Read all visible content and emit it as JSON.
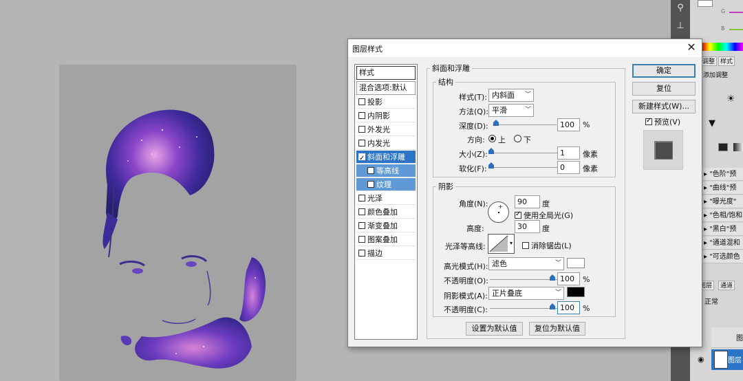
{
  "dialog": {
    "title": "图层样式",
    "close_icon": "close-icon"
  },
  "style_list": {
    "header": "样式",
    "blend_options": "混合选项:默认",
    "items": [
      {
        "label": "投影",
        "checked": false
      },
      {
        "label": "内阴影",
        "checked": false
      },
      {
        "label": "外发光",
        "checked": false
      },
      {
        "label": "内发光",
        "checked": false
      },
      {
        "label": "斜面和浮雕",
        "checked": true,
        "selected": true
      },
      {
        "label": "等高线",
        "checked": false,
        "sub": true
      },
      {
        "label": "纹理",
        "checked": false,
        "sub": true
      },
      {
        "label": "光泽",
        "checked": false
      },
      {
        "label": "颜色叠加",
        "checked": false
      },
      {
        "label": "渐变叠加",
        "checked": false
      },
      {
        "label": "图案叠加",
        "checked": false
      },
      {
        "label": "描边",
        "checked": false
      }
    ]
  },
  "bevel": {
    "title": "斜面和浮雕",
    "structure": {
      "title": "结构",
      "style_label": "样式(T):",
      "style_value": "内斜面",
      "technique_label": "方法(Q):",
      "technique_value": "平滑",
      "depth_label": "深度(D):",
      "depth_value": "100",
      "depth_unit": "%",
      "depth_level": 1.0,
      "direction_label": "方向:",
      "dir_up": "上",
      "dir_down": "下",
      "direction_selected": "上",
      "size_label": "大小(Z):",
      "size_value": "1",
      "size_unit": "像素",
      "soften_label": "软化(F):",
      "soften_value": "0",
      "soften_unit": "像素"
    },
    "shading": {
      "title": "阴影",
      "angle_label": "角度(N):",
      "angle_value": "90",
      "angle_unit": "度",
      "global_light_label": "使用全局光(G)",
      "global_light_checked": true,
      "altitude_label": "高度:",
      "altitude_value": "30",
      "altitude_unit": "度",
      "gloss_contour_label": "光泽等高线:",
      "antialias_label": "消除锯齿(L)",
      "antialias_checked": false,
      "highlight_mode_label": "高光模式(H):",
      "highlight_mode_value": "滤色",
      "highlight_color": "#ffffff",
      "highlight_opacity_label": "不透明度(O):",
      "highlight_opacity_value": "100",
      "shadow_mode_label": "阴影模式(A):",
      "shadow_mode_value": "正片叠底",
      "shadow_color": "#000000",
      "shadow_opacity_label": "不透明度(C):",
      "shadow_opacity_value": "100",
      "percent": "%"
    },
    "make_default": "设置为默认值",
    "reset_default": "复位为默认值"
  },
  "buttons": {
    "ok": "确定",
    "reset": "复位",
    "new_style": "新建样式(W)...",
    "preview_label": "预览(V)",
    "preview_checked": true
  },
  "right_panel": {
    "tabs": [
      "调整",
      "样式"
    ],
    "adjust_label": "添加调整",
    "adjust_rows": [
      "\"色阶\"预",
      "\"曲线\"预",
      "\"曝光度\"",
      "\"色相/饱和",
      "\"黑白\"预",
      "\"通道混和",
      "\"可选颜色"
    ],
    "layer_tabs": [
      "图层",
      "通道"
    ],
    "blend_mode": "正常",
    "layer_names": [
      "图",
      "图层"
    ],
    "channel_labels": [
      "G",
      "B"
    ],
    "accent": "#2b74c7"
  }
}
